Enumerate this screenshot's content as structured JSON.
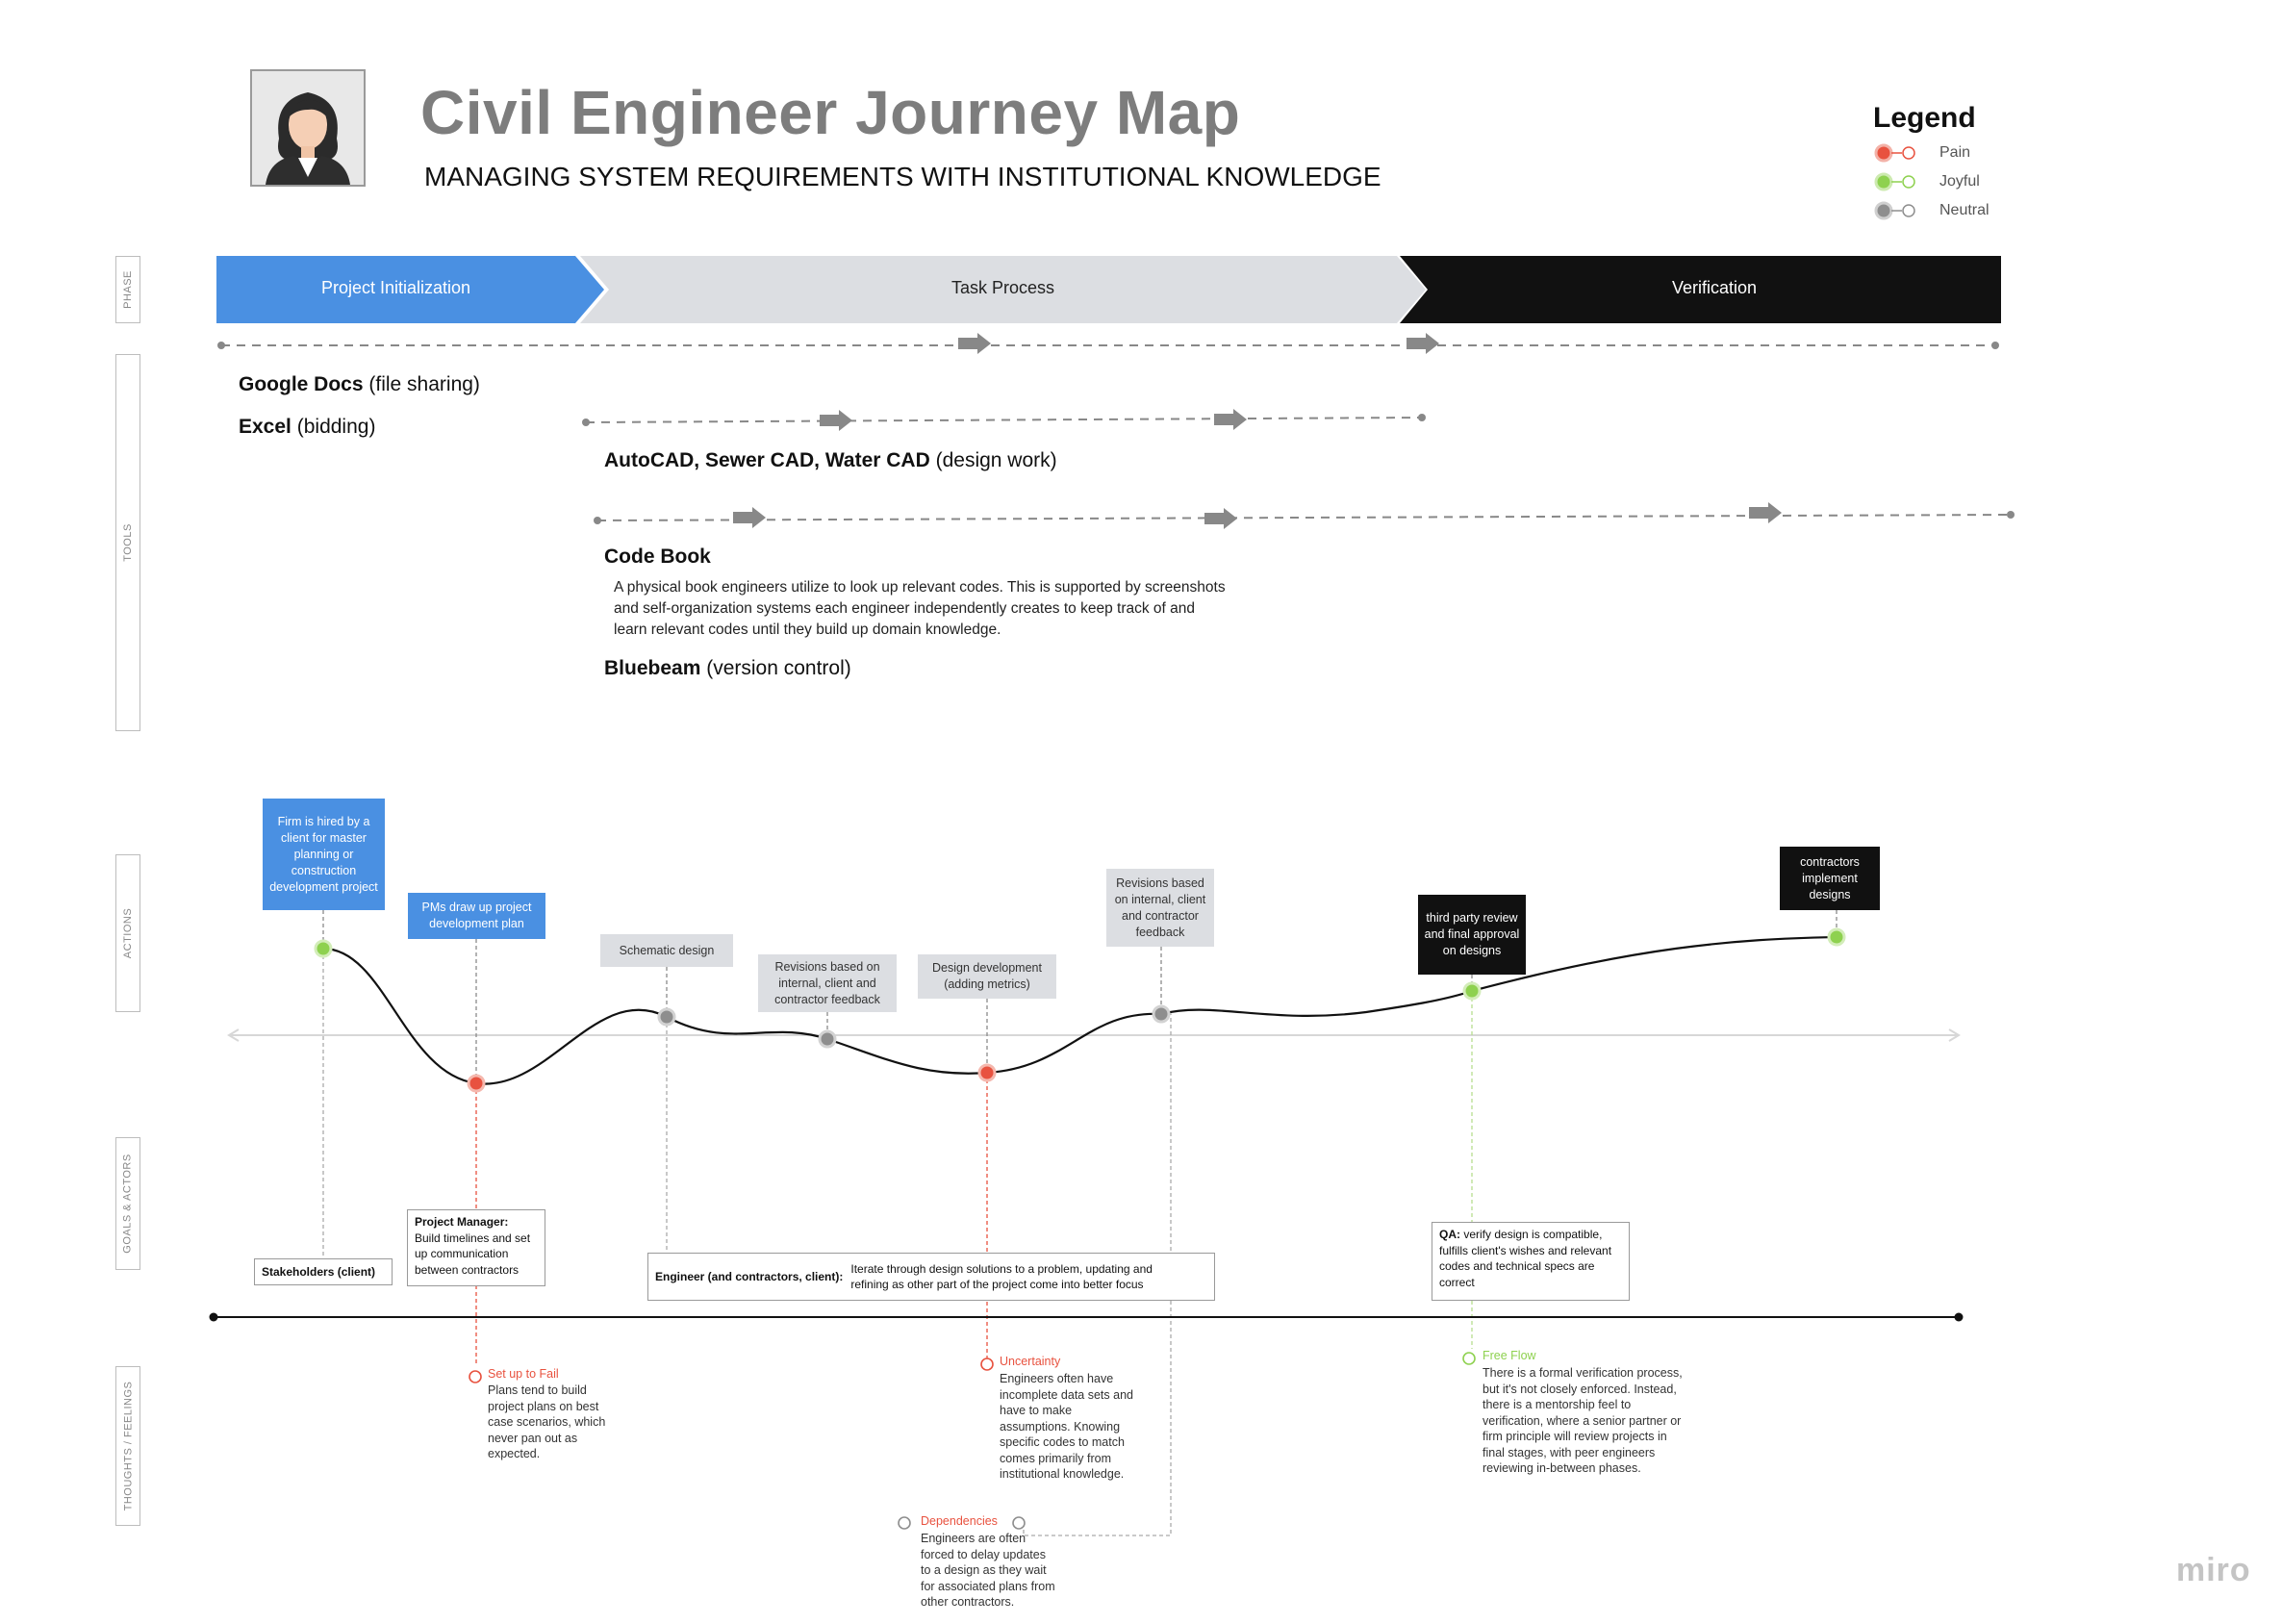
{
  "header": {
    "title": "Civil Engineer Journey Map",
    "subtitle": "MANAGING SYSTEM REQUIREMENTS WITH INSTITUTIONAL KNOWLEDGE"
  },
  "legend": {
    "title": "Legend",
    "items": [
      {
        "label": "Pain",
        "color": "#e8523f"
      },
      {
        "label": "Joyful",
        "color": "#8ed14f"
      },
      {
        "label": "Neutral",
        "color": "#8e8e8e"
      }
    ]
  },
  "row_labels": {
    "phase": "PHASE",
    "tools": "TOOLS",
    "actions": "ACTIONS",
    "goals": "GOALS & ACTORS",
    "thoughts": "THOUGHTS / FEELINGS"
  },
  "phases": [
    {
      "label": "Project Initialization",
      "color": "#4a90e2"
    },
    {
      "label": "Task Process",
      "color": "#dcdee2"
    },
    {
      "label": "Verification",
      "color": "#111111"
    }
  ],
  "tools": {
    "google_docs": {
      "name": "Google Docs",
      "note": "(file sharing)"
    },
    "excel": {
      "name": "Excel",
      "note": "(bidding)"
    },
    "autocad": {
      "name": "AutoCAD, Sewer CAD, Water CAD",
      "note": "(design work)"
    },
    "code_book": {
      "name": "Code Book",
      "description": "A physical book engineers utilize to look up relevant codes. This is supported by screenshots and self-organization systems each engineer independently creates to keep track of and learn relevant codes until they build up domain knowledge."
    },
    "bluebeam": {
      "name": "Bluebeam",
      "note": "(version control)"
    }
  },
  "actions": [
    {
      "text": "Firm is hired by a client for master planning or construction development project",
      "sentiment": "joyful"
    },
    {
      "text": "PMs draw up project development plan",
      "sentiment": "pain"
    },
    {
      "text": "Schematic design",
      "sentiment": "neutral"
    },
    {
      "text": "Revisions based on internal, client and contractor feedback",
      "sentiment": "neutral"
    },
    {
      "text": "Design development (adding metrics)",
      "sentiment": "pain"
    },
    {
      "text": "Revisions based on internal, client and contractor feedback",
      "sentiment": "neutral"
    },
    {
      "text": "third party review and final approval on designs",
      "sentiment": "joyful"
    },
    {
      "text": "contractors implement designs",
      "sentiment": "joyful"
    }
  ],
  "goals": {
    "stakeholders": "Stakeholders (client)",
    "pm_actor": "Project Manager:",
    "pm_goal": "Build timelines and set up communication between contractors",
    "engineer_actor": "Engineer (and contractors, client):",
    "engineer_goal": "Iterate through design solutions to a problem, updating and refining as other part of the project come into better focus",
    "qa_actor": "QA:",
    "qa_goal": "verify design is compatible, fulfills client's wishes and relevant codes and technical specs are correct"
  },
  "thoughts": [
    {
      "title": "Set up to Fail",
      "body": "Plans tend to build project plans on best case scenarios, which never pan out as expected.",
      "sentiment": "pain"
    },
    {
      "title": "Uncertainty",
      "body": "Engineers often have incomplete data sets and have to make assumptions. Knowing specific codes to match comes primarily from institutional knowledge.",
      "sentiment": "pain"
    },
    {
      "title": "Dependencies",
      "body": "Engineers are often forced to delay updates to a design as they wait for associated plans from other contractors.",
      "sentiment": "pain"
    },
    {
      "title": "Free Flow",
      "body": "There is a formal verification process, but it's not closely enforced. Instead, there is a mentorship feel to verification, where a senior partner or firm principle will review projects in final stages, with peer engineers reviewing in-between phases.",
      "sentiment": "joyful"
    }
  ],
  "watermark": "miro"
}
